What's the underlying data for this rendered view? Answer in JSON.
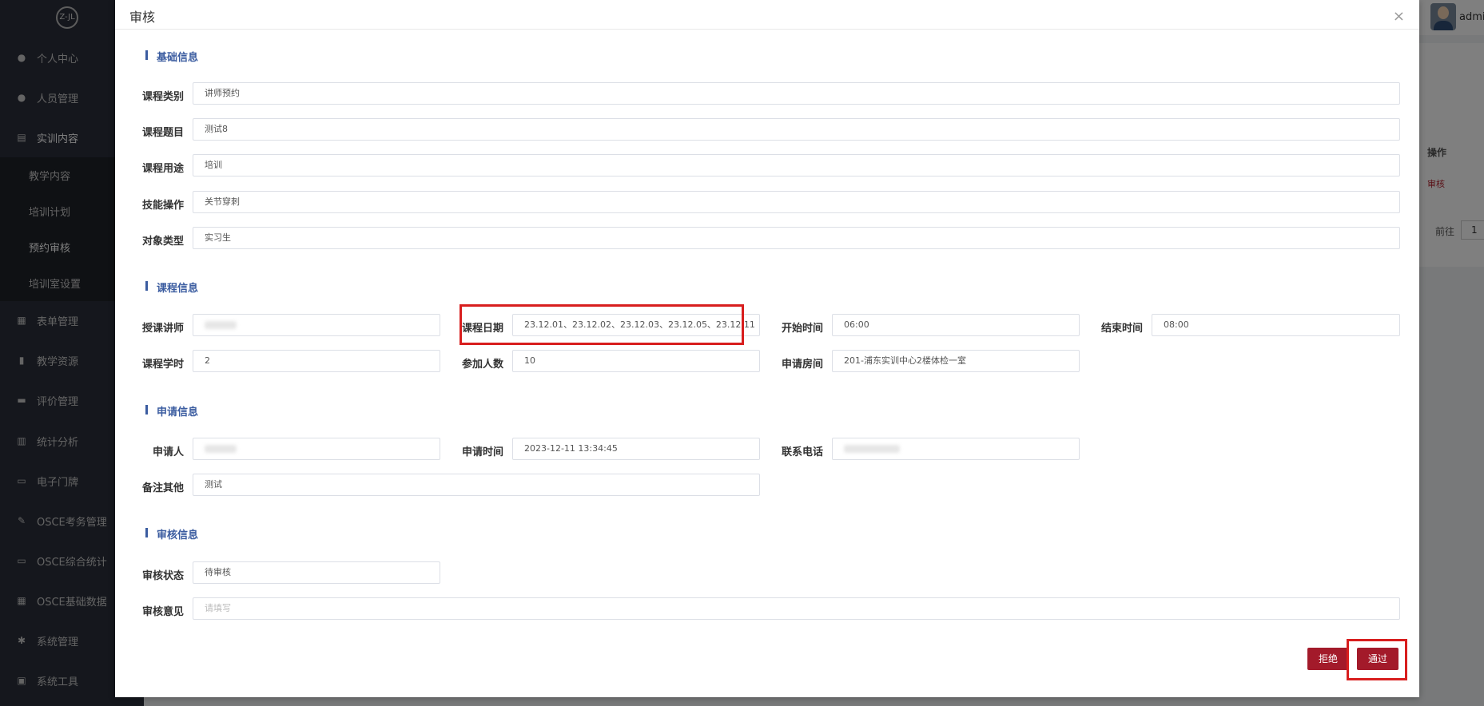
{
  "sidebar": {
    "logo_text": "Z-JL",
    "items": [
      {
        "label": "个人中心",
        "icon": "user-icon"
      },
      {
        "label": "人员管理",
        "icon": "users-icon"
      },
      {
        "label": "实训内容",
        "icon": "document-icon"
      },
      {
        "label": "表单管理",
        "icon": "form-icon"
      },
      {
        "label": "教学资源",
        "icon": "resource-icon"
      },
      {
        "label": "评价管理",
        "icon": "evaluate-icon"
      },
      {
        "label": "统计分析",
        "icon": "bar-chart-icon"
      },
      {
        "label": "电子门牌",
        "icon": "monitor-icon"
      },
      {
        "label": "OSCE考务管理",
        "icon": "exam-icon"
      },
      {
        "label": "OSCE综合统计",
        "icon": "stats-icon"
      },
      {
        "label": "OSCE基础数据",
        "icon": "grid-icon"
      },
      {
        "label": "系统管理",
        "icon": "gear-icon"
      },
      {
        "label": "系统工具",
        "icon": "toolbox-icon"
      }
    ],
    "sub_items": [
      {
        "label": "教学内容"
      },
      {
        "label": "培训计划"
      },
      {
        "label": "预约审核"
      },
      {
        "label": "培训室设置"
      }
    ]
  },
  "header": {
    "user_name": "admi"
  },
  "background": {
    "op_header": "操作",
    "op_link": "审核",
    "goto_label": "前往",
    "goto_value": "1"
  },
  "dialog": {
    "title": "审核",
    "close": "×",
    "sections": {
      "basic": "基础信息",
      "course": "课程信息",
      "apply": "申请信息",
      "review": "审核信息"
    },
    "basic": {
      "category_label": "课程类别",
      "category_value": "讲师预约",
      "topic_label": "课程题目",
      "topic_value": "测试8",
      "purpose_label": "课程用途",
      "purpose_value": "培训",
      "skill_label": "技能操作",
      "skill_value": "关节穿刺",
      "target_label": "对象类型",
      "target_value": "实习生"
    },
    "course": {
      "teacher_label": "授课讲师",
      "date_label": "课程日期",
      "date_value": "23.12.01、23.12.02、23.12.03、23.12.05、23.12.11",
      "start_label": "开始时间",
      "start_value": "06:00",
      "end_label": "结束时间",
      "end_value": "08:00",
      "hours_label": "课程学时",
      "hours_value": "2",
      "count_label": "参加人数",
      "count_value": "10",
      "room_label": "申请房间",
      "room_value": "201-浦东实训中心2楼体检一室"
    },
    "apply": {
      "applicant_label": "申请人",
      "time_label": "申请时间",
      "time_value": "2023-12-11 13:34:45",
      "phone_label": "联系电话",
      "remark_label": "备注其他",
      "remark_value": "测试"
    },
    "review": {
      "status_label": "审核状态",
      "status_value": "待审核",
      "opinion_label": "审核意见",
      "opinion_placeholder": "请填写"
    },
    "buttons": {
      "reject": "拒绝",
      "approve": "通过"
    }
  }
}
